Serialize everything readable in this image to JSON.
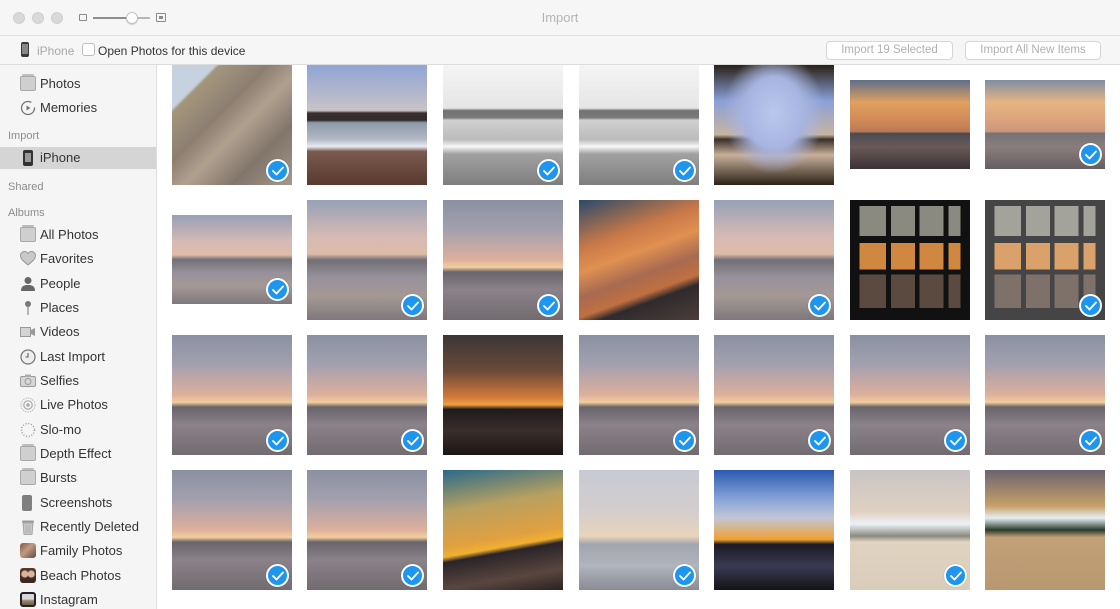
{
  "window": {
    "title": "Import",
    "zoom_slider_level": 0.65
  },
  "toolbar": {
    "device_name": "iPhone",
    "open_photos_label": "Open Photos for this device",
    "open_photos_checked": false,
    "import_selected_label": "Import 19 Selected",
    "import_all_label": "Import All New Items"
  },
  "sidebar": {
    "library": [
      {
        "label": "Photos",
        "icon": "photos-icon"
      },
      {
        "label": "Memories",
        "icon": "memories-icon"
      }
    ],
    "import_header": "Import",
    "import_items": [
      {
        "label": "iPhone",
        "icon": "iphone-icon",
        "selected": true
      }
    ],
    "shared_header": "Shared",
    "albums_header": "Albums",
    "albums": [
      {
        "label": "All Photos",
        "icon": "album-icon"
      },
      {
        "label": "Favorites",
        "icon": "heart-icon"
      },
      {
        "label": "People",
        "icon": "person-icon"
      },
      {
        "label": "Places",
        "icon": "pin-icon"
      },
      {
        "label": "Videos",
        "icon": "video-icon"
      },
      {
        "label": "Last Import",
        "icon": "clock-icon"
      },
      {
        "label": "Selfies",
        "icon": "camera-icon"
      },
      {
        "label": "Live Photos",
        "icon": "live-photo-icon"
      },
      {
        "label": "Slo-mo",
        "icon": "slomo-icon"
      },
      {
        "label": "Depth Effect",
        "icon": "album-icon"
      },
      {
        "label": "Bursts",
        "icon": "album-icon"
      },
      {
        "label": "Screenshots",
        "icon": "screenshot-icon"
      },
      {
        "label": "Recently Deleted",
        "icon": "trash-icon"
      },
      {
        "label": "Family Photos",
        "icon": "family-photos-thumbnail"
      },
      {
        "label": "Beach Photos",
        "icon": "beach-photos-thumbnail"
      },
      {
        "label": "Instagram",
        "icon": "instagram-thumbnail"
      }
    ]
  },
  "photos": [
    {
      "row": 0,
      "col": 0,
      "scene": "rocky cliff",
      "selected": true,
      "shape": "square"
    },
    {
      "row": 0,
      "col": 1,
      "scene": "beach waves dusk",
      "selected": false,
      "shape": "square"
    },
    {
      "row": 0,
      "col": 2,
      "scene": "beach waves black and white",
      "selected": true,
      "shape": "square"
    },
    {
      "row": 0,
      "col": 3,
      "scene": "beach waves black and white",
      "selected": true,
      "shape": "square"
    },
    {
      "row": 0,
      "col": 4,
      "scene": "beach framed by trees",
      "selected": false,
      "shape": "square"
    },
    {
      "row": 0,
      "col": 5,
      "scene": "sunset over sea",
      "selected": false,
      "shape": "landscape"
    },
    {
      "row": 0,
      "col": 6,
      "scene": "sunset over sea",
      "selected": true,
      "shape": "landscape"
    },
    {
      "row": 1,
      "col": 0,
      "scene": "sunset beach",
      "selected": true,
      "shape": "landscape"
    },
    {
      "row": 1,
      "col": 1,
      "scene": "sunset beach",
      "selected": true,
      "shape": "square"
    },
    {
      "row": 1,
      "col": 2,
      "scene": "sunset sea",
      "selected": true,
      "shape": "square"
    },
    {
      "row": 1,
      "col": 3,
      "scene": "dramatic sunset",
      "selected": false,
      "shape": "square"
    },
    {
      "row": 1,
      "col": 4,
      "scene": "sunset beach",
      "selected": true,
      "shape": "square"
    },
    {
      "row": 1,
      "col": 5,
      "scene": "sunset through window",
      "selected": false,
      "shape": "square"
    },
    {
      "row": 1,
      "col": 6,
      "scene": "sunset through window",
      "selected": true,
      "shape": "square"
    },
    {
      "row": 2,
      "col": 0,
      "scene": "sunset sea",
      "selected": true,
      "shape": "square"
    },
    {
      "row": 2,
      "col": 1,
      "scene": "sunset sea",
      "selected": true,
      "shape": "square"
    },
    {
      "row": 2,
      "col": 2,
      "scene": "dark sunset",
      "selected": false,
      "shape": "square"
    },
    {
      "row": 2,
      "col": 3,
      "scene": "sunset sea",
      "selected": true,
      "shape": "square"
    },
    {
      "row": 2,
      "col": 4,
      "scene": "sunset sea",
      "selected": true,
      "shape": "square"
    },
    {
      "row": 2,
      "col": 5,
      "scene": "sunset sea",
      "selected": true,
      "shape": "square"
    },
    {
      "row": 2,
      "col": 6,
      "scene": "sunset sea",
      "selected": true,
      "shape": "square"
    },
    {
      "row": 3,
      "col": 0,
      "scene": "sunset sea",
      "selected": true,
      "shape": "square"
    },
    {
      "row": 3,
      "col": 1,
      "scene": "sunset sea",
      "selected": true,
      "shape": "square"
    },
    {
      "row": 3,
      "col": 2,
      "scene": "golden sunset",
      "selected": false,
      "shape": "square"
    },
    {
      "row": 3,
      "col": 3,
      "scene": "cloudy sunset",
      "selected": true,
      "shape": "square"
    },
    {
      "row": 3,
      "col": 4,
      "scene": "drone at sunset",
      "selected": false,
      "shape": "square"
    },
    {
      "row": 3,
      "col": 5,
      "scene": "beach huts",
      "selected": true,
      "shape": "square"
    },
    {
      "row": 3,
      "col": 6,
      "scene": "beach huts sand tracks",
      "selected": false,
      "shape": "square"
    }
  ],
  "colors": {
    "accent": "#1e96f0",
    "sidebar_bg": "#f5f5f5",
    "sidebar_selected": "#d5d5d5",
    "titlebar_bg": "#f6f6f6"
  }
}
